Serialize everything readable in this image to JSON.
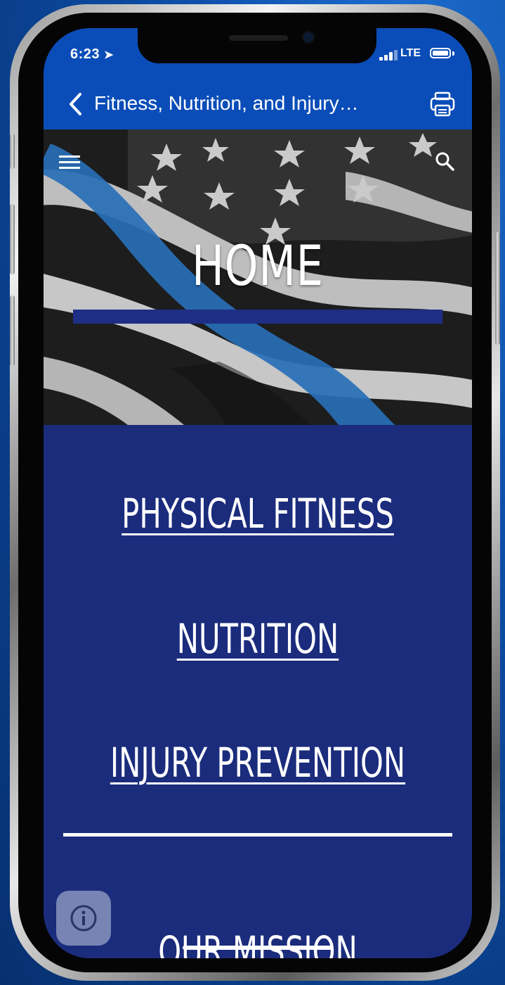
{
  "status_bar": {
    "time": "6:23",
    "location_icon": "location-arrow-icon",
    "network": "LTE",
    "signal_icon": "signal-bars-icon",
    "battery_icon": "battery-icon"
  },
  "nav_bar": {
    "back_icon": "chevron-left-icon",
    "title": "Fitness, Nutrition, and Injury…",
    "print_icon": "printer-icon"
  },
  "hero": {
    "title": "HOME",
    "menu_icon": "hamburger-menu-icon",
    "search_icon": "search-icon"
  },
  "links": [
    {
      "label": "PHYSICAL FITNESS"
    },
    {
      "label": "NUTRITION"
    },
    {
      "label": "INJURY PREVENTION"
    },
    {
      "label": "OUR MISSION"
    }
  ],
  "info_button": {
    "icon": "info-icon"
  },
  "colors": {
    "bar_blue": "#0a4db8",
    "content_blue": "#1b2c7c",
    "accent_blue": "#1e2e85",
    "background": "#0d4ea8"
  }
}
